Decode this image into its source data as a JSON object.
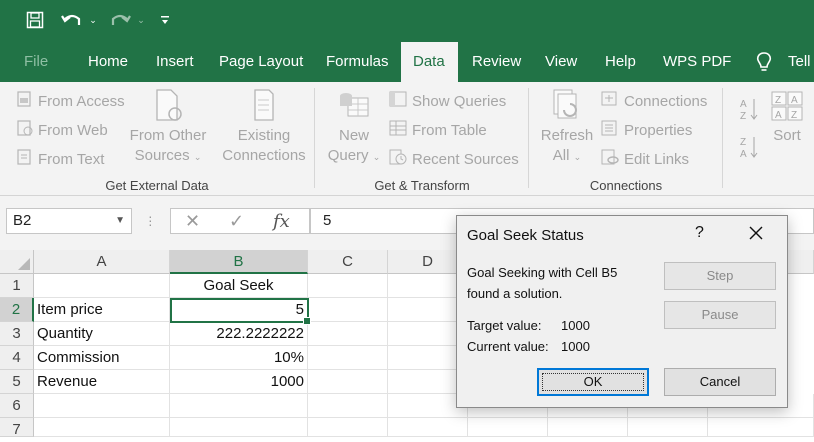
{
  "quick_access": {
    "save_icon": "save-icon",
    "undo_icon": "undo-icon",
    "redo_icon": "redo-icon",
    "customize_icon": "customize-qat-icon"
  },
  "tabs": {
    "file": "File",
    "home": "Home",
    "insert": "Insert",
    "page_layout": "Page Layout",
    "formulas": "Formulas",
    "data": "Data",
    "review": "Review",
    "view": "View",
    "help": "Help",
    "wps_pdf": "WPS PDF",
    "tell": "Tell"
  },
  "ribbon": {
    "get_external_data": {
      "from_access": "From Access",
      "from_web": "From Web",
      "from_text": "From Text",
      "from_other_1": "From Other",
      "from_other_2": "Sources",
      "existing_1": "Existing",
      "existing_2": "Connections",
      "group_label": "Get External Data"
    },
    "get_transform": {
      "new_query_1": "New",
      "new_query_2": "Query",
      "show_queries": "Show Queries",
      "from_table": "From Table",
      "recent_sources": "Recent Sources",
      "group_label": "Get & Transform"
    },
    "connections": {
      "refresh_1": "Refresh",
      "refresh_2": "All",
      "connections": "Connections",
      "properties": "Properties",
      "edit_links": "Edit Links",
      "group_label": "Connections"
    },
    "sort": {
      "sort": "Sort"
    }
  },
  "formula_bar": {
    "name_box": "B2",
    "cancel": "✕",
    "enter": "✓",
    "fx": "fx",
    "value": "5"
  },
  "grid": {
    "columns": [
      "A",
      "B",
      "C",
      "D"
    ],
    "rows": [
      "1",
      "2",
      "3",
      "4",
      "5",
      "6",
      "7"
    ],
    "cells": {
      "B1": "Goal Seek",
      "A2": "Item price",
      "B2": "5",
      "A3": "Quantity",
      "B3": "222.2222222",
      "A4": "Commission",
      "B4": "10%",
      "A5": "Revenue",
      "B5": "1000"
    }
  },
  "dialog": {
    "title": "Goal Seek Status",
    "help": "?",
    "message_line1": "Goal Seeking with Cell B5",
    "message_line2": "found a solution.",
    "target_label": "Target value:",
    "target_value": "1000",
    "current_label": "Current value:",
    "current_value": "1000",
    "step": "Step",
    "pause": "Pause",
    "ok": "OK",
    "cancel": "Cancel"
  },
  "colors": {
    "accent": "#217346",
    "ribbon_bg": "#f3f3f3",
    "disabled_text": "#a6a6a6",
    "dialog_default_border": "#0078d7"
  }
}
